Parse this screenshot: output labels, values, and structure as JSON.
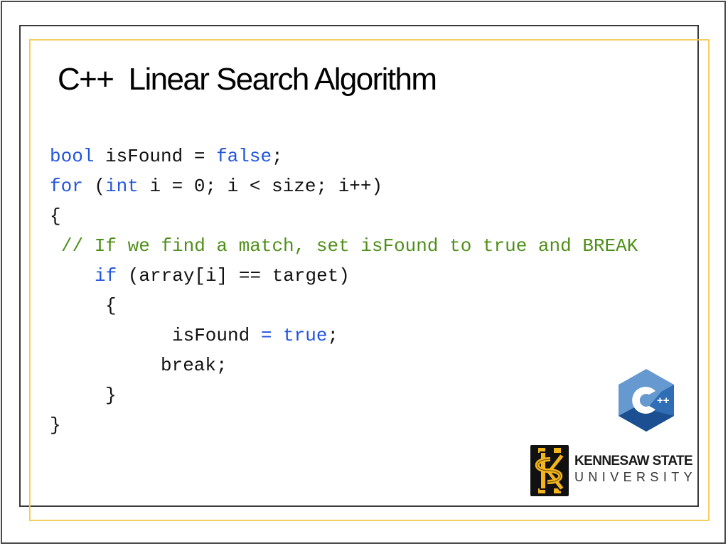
{
  "slide": {
    "title": "C++  Linear Search Algorithm",
    "code_lines": [
      {
        "tokens": [
          {
            "t": "bool",
            "c": "kw"
          },
          {
            "t": " isFound = ",
            "c": "plain"
          },
          {
            "t": "false",
            "c": "kw"
          },
          {
            "t": ";",
            "c": "plain"
          }
        ]
      },
      {
        "tokens": [
          {
            "t": "for",
            "c": "kw"
          },
          {
            "t": " (",
            "c": "plain"
          },
          {
            "t": "int",
            "c": "kw"
          },
          {
            "t": " i = 0; i < size; i++)",
            "c": "plain"
          }
        ]
      },
      {
        "tokens": [
          {
            "t": "{",
            "c": "plain"
          }
        ]
      },
      {
        "tokens": [
          {
            "t": "// If we find a match, set isFound to true and BREAK",
            "c": "cm"
          }
        ]
      },
      {
        "tokens": [
          {
            "t": "if",
            "c": "kw"
          },
          {
            "t": " (array[i] == target)",
            "c": "plain"
          }
        ]
      },
      {
        "tokens": [
          {
            "t": "{",
            "c": "plain"
          }
        ]
      },
      {
        "tokens": [
          {
            "t": "isFound ",
            "c": "plain"
          },
          {
            "t": "=",
            "c": "kw"
          },
          {
            "t": " ",
            "c": "plain"
          },
          {
            "t": "true",
            "c": "kw"
          },
          {
            "t": ";",
            "c": "plain"
          }
        ]
      },
      {
        "tokens": [
          {
            "t": "break;",
            "c": "plain"
          }
        ]
      },
      {
        "tokens": [
          {
            "t": "}",
            "c": "plain"
          }
        ]
      },
      {
        "tokens": [
          {
            "t": "}",
            "c": "plain"
          }
        ]
      }
    ],
    "colors": {
      "keyword": "#2255dd",
      "comment": "#4f8f19",
      "accent_gold": "#f2c94c"
    }
  },
  "logos": {
    "cpp": {
      "icon": "cpp-logo-icon",
      "glyph": "C",
      "suffix": "++"
    },
    "ksu": {
      "icon": "ksu-emblem-icon",
      "line1": "KENNESAW STATE",
      "line2": "UNIVERSITY"
    }
  }
}
